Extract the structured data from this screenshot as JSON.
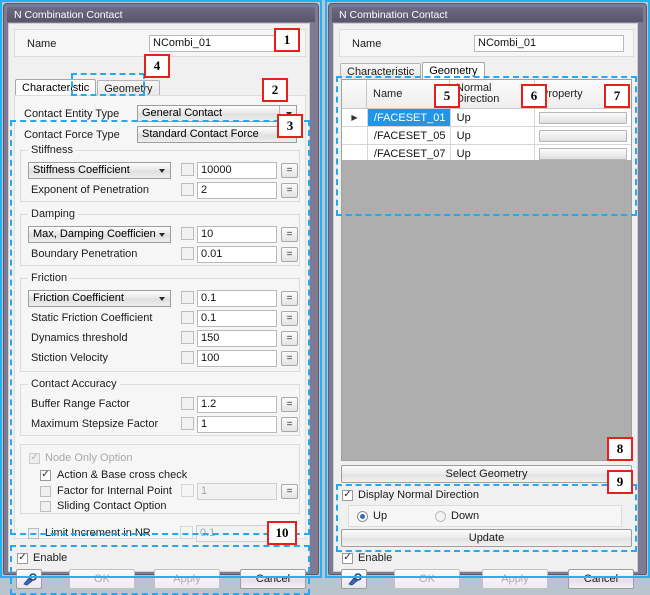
{
  "left_window": {
    "title": "N Combination Contact",
    "name_label": "Name",
    "name_value": "NCombi_01",
    "tabs": [
      {
        "label": "Characteristic",
        "active": true
      },
      {
        "label": "Geometry",
        "active": false
      }
    ],
    "contact_entity_type": {
      "label": "Contact Entity Type",
      "value": "General Contact"
    },
    "contact_force_type": {
      "label": "Contact Force Type",
      "value": "Standard Contact Force"
    },
    "stiffness": {
      "title": "Stiffness",
      "coefficient_combo": "Stiffness Coefficient",
      "coefficient_value": "10000",
      "exponent_label": "Exponent of Penetration",
      "exponent_value": "2"
    },
    "damping": {
      "title": "Damping",
      "combo": "Max, Damping Coefficient",
      "combo_value": "10",
      "boundary_label": "Boundary Penetration",
      "boundary_value": "0.01"
    },
    "friction": {
      "title": "Friction",
      "combo": "Friction Coefficient",
      "combo_value": "0.1",
      "static_label": "Static Friction Coefficient",
      "static_value": "0.1",
      "dynamics_label": "Dynamics threshold",
      "dynamics_value": "150",
      "stiction_label": "Stiction Velocity",
      "stiction_value": "100"
    },
    "accuracy": {
      "title": "Contact Accuracy",
      "buffer_label": "Buffer Range Factor",
      "buffer_value": "1.2",
      "stepsize_label": "Maximum Stepsize Factor",
      "stepsize_value": "1"
    },
    "node_options": {
      "node_only": "Node Only Option",
      "cross_check": "Action & Base cross check",
      "internal_point": "Factor for Internal Point",
      "internal_point_value": "1",
      "sliding": "Sliding Contact Option"
    },
    "limit_increment": {
      "label": "Limit Increment in NR",
      "value": "0.1"
    },
    "enable_label": "Enable",
    "buttons": {
      "ok": "OK",
      "apply": "Apply",
      "cancel": "Cancel"
    }
  },
  "right_window": {
    "title": "N Combination Contact",
    "name_label": "Name",
    "name_value": "NCombi_01",
    "tabs": [
      {
        "label": "Characteristic",
        "active": false
      },
      {
        "label": "Geometry",
        "active": true
      }
    ],
    "table": {
      "columns": [
        "Name",
        "Normal Direction",
        "Property"
      ],
      "col_normal_line1": "Normal",
      "col_normal_line2": "Direction",
      "rows": [
        {
          "marker": "▶",
          "name": "/FACESET_01",
          "normal": "Up",
          "property": "",
          "selected": true
        },
        {
          "marker": "",
          "name": "/FACESET_05",
          "normal": "Up",
          "property": "",
          "selected": false
        },
        {
          "marker": "",
          "name": "/FACESET_07",
          "normal": "Up",
          "property": "",
          "selected": false
        }
      ]
    },
    "select_geometry": "Select Geometry",
    "display_normal": "Display Normal Direction",
    "radio_up": "Up",
    "radio_down": "Down",
    "update": "Update",
    "enable_label": "Enable",
    "buttons": {
      "ok": "OK",
      "apply": "Apply",
      "cancel": "Cancel"
    }
  },
  "annotations": {
    "b1": "1",
    "b2": "2",
    "b3": "3",
    "b4": "4",
    "b5": "5",
    "b6": "6",
    "b7": "7",
    "b8": "8",
    "b9": "9",
    "b10": "10"
  },
  "colors": {
    "annotation_red": "#e8201c",
    "annotation_blue": "#22a9f0",
    "window_outline": "#22b2f0",
    "selection_blue": "#2196e8",
    "titlebar": "#57546b"
  }
}
